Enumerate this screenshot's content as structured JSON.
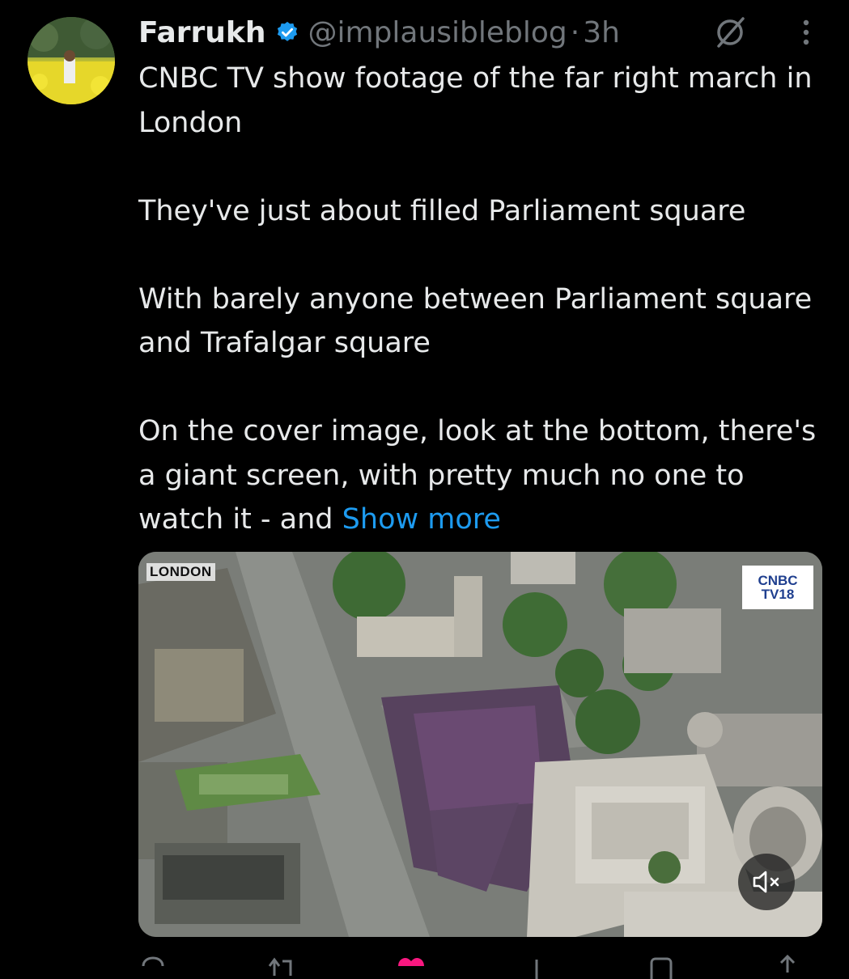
{
  "author": {
    "name": "Farrukh",
    "handle": "@implausibleblog",
    "separator": "·",
    "time": "3h",
    "verified": true
  },
  "tweet": {
    "paragraphs": [
      "CNBC TV show footage of the far right march in London",
      "They've just about filled Parliament square",
      "With barely anyone between Parliament square and Trafalgar square"
    ],
    "last_paragraph": "On the cover image, look at the bottom, there's a giant screen, with pretty much no one to watch it - and",
    "show_more": "Show more"
  },
  "media": {
    "location_label": "LONDON",
    "channel_logo": {
      "line1": "CNBC",
      "line2": "TV18"
    }
  },
  "colors": {
    "background": "#000000",
    "text": "#e7e9ea",
    "muted": "#71767b",
    "link": "#1d9bf0",
    "like": "#f91880",
    "verified": "#1d9bf0"
  },
  "icons": [
    "verified-badge-icon",
    "grok-icon",
    "more-options-icon",
    "mute-icon",
    "reply-icon",
    "retweet-icon",
    "like-icon",
    "views-icon",
    "bookmark-icon",
    "share-icon"
  ]
}
